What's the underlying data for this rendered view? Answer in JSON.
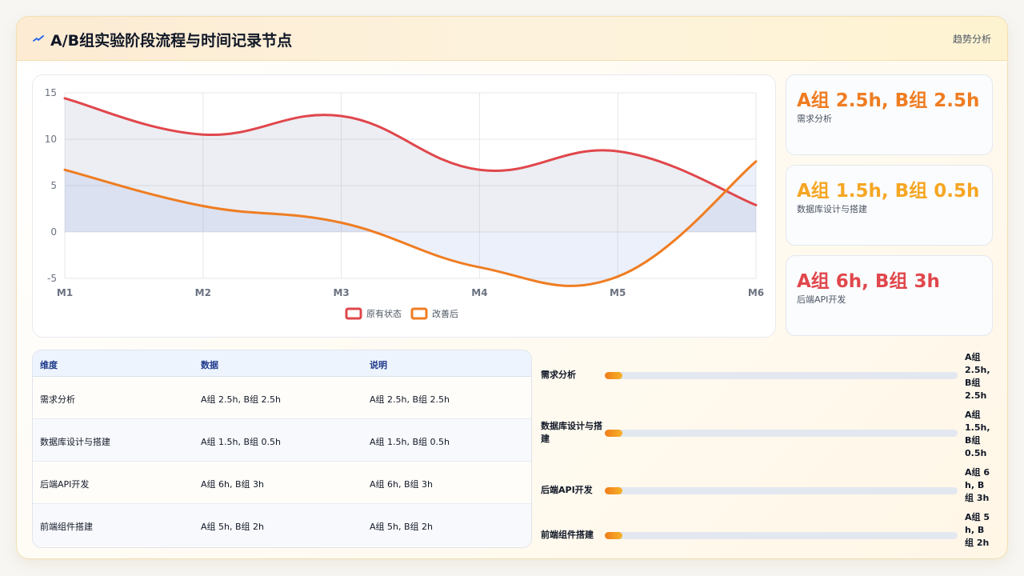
{
  "header": {
    "title": "A/B组实验阶段流程与时间记录节点",
    "action": "趋势分析",
    "icon": "activity-icon"
  },
  "chart_data": {
    "type": "area",
    "categories": [
      "M1",
      "M2",
      "M3",
      "M4",
      "M5",
      "M6"
    ],
    "ylim": [
      -5,
      15
    ],
    "yticks": [
      15,
      10,
      5,
      0,
      -5
    ],
    "grid": true,
    "legend_position": "bottom",
    "series": [
      {
        "name": "原有状态",
        "values": [
          14.4,
          10.5,
          12.5,
          6.7,
          8.7,
          2.9
        ],
        "color": "#e0474c"
      },
      {
        "name": "改善后",
        "values": [
          6.7,
          2.8,
          1.0,
          -3.8,
          -4.8,
          7.6
        ],
        "color": "#ef7d22"
      }
    ]
  },
  "stats": [
    {
      "value": "A组 2.5h, B组 2.5h",
      "label": "需求分析",
      "color": "#ef7d22"
    },
    {
      "value": "A组 1.5h, B组 0.5h",
      "label": "数据库设计与搭建",
      "color": "#f5a623"
    },
    {
      "value": "A组 6h, B组 3h",
      "label": "后端API开发",
      "color": "#e0474c"
    }
  ],
  "table": {
    "headers": [
      "维度",
      "数据",
      "说明"
    ],
    "rows": [
      [
        "需求分析",
        "A组 2.5h, B组 2.5h",
        "A组 2.5h, B组 2.5h"
      ],
      [
        "数据库设计与搭建",
        "A组 1.5h, B组 0.5h",
        "A组 1.5h, B组 0.5h"
      ],
      [
        "后端API开发",
        "A组 6h, B组 3h",
        "A组 6h, B组 3h"
      ],
      [
        "前端组件搭建",
        "A组 5h, B组 2h",
        "A组 5h, B组 2h"
      ]
    ]
  },
  "progress": [
    {
      "label": "需求分析",
      "value": "A组 2.5h, B组 2.5h",
      "fraction": 0.05
    },
    {
      "label": "数据库设计与搭建",
      "value": "A组 1.5h, B组 0.5h",
      "fraction": 0.05
    },
    {
      "label": "后端API开发",
      "value": "A组 6h, B组 3h",
      "fraction": 0.05
    },
    {
      "label": "前端组件搭建",
      "value": "A组 5h, B组 2h",
      "fraction": 0.05
    }
  ]
}
